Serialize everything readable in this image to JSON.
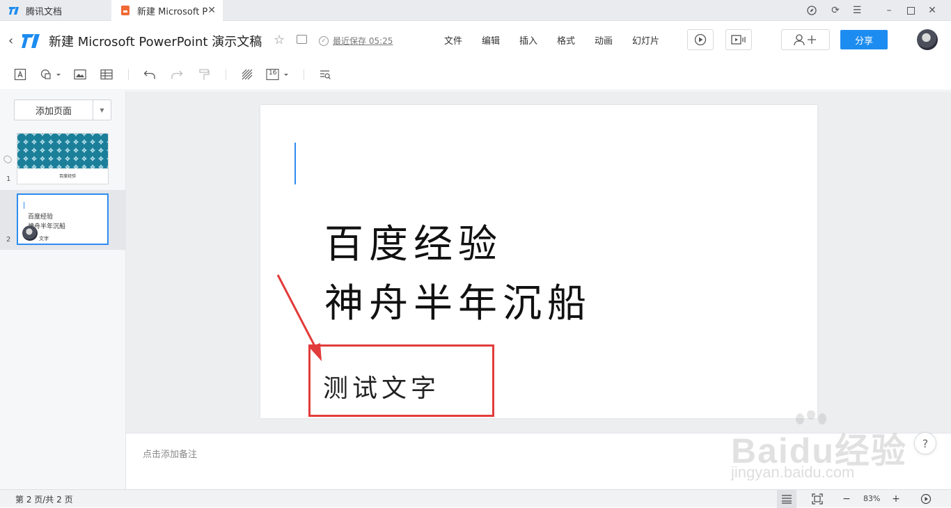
{
  "window": {
    "tabs": [
      {
        "label": "腾讯文档"
      },
      {
        "label": "新建 Microsoft P"
      }
    ]
  },
  "header": {
    "title": "新建 Microsoft PowerPoint 演示文稿",
    "saved": "最近保存 05:25",
    "menu": [
      "文件",
      "编辑",
      "插入",
      "格式",
      "动画",
      "幻灯片"
    ],
    "share_label": "分享"
  },
  "toolbar": {
    "font_size": "16"
  },
  "sidebar": {
    "add_page": "添加页面",
    "slides": [
      {
        "number": "1",
        "caption": "百度经验"
      },
      {
        "number": "2",
        "lines": [
          "百度经验",
          "神舟半年沉船",
          "文字"
        ]
      }
    ]
  },
  "slide": {
    "line1": "百度经验",
    "line2": "神舟半年沉船",
    "test_text": "测试文字"
  },
  "notes": {
    "placeholder": "点击添加备注"
  },
  "watermark": {
    "brand": "Baidu经验",
    "url": "jingyan.baidu.com"
  },
  "status": {
    "page_info": "第 2 页/共 2 页",
    "zoom": "83%"
  },
  "colors": {
    "accent": "#1d8cf0",
    "annotation": "#e23b3b"
  }
}
